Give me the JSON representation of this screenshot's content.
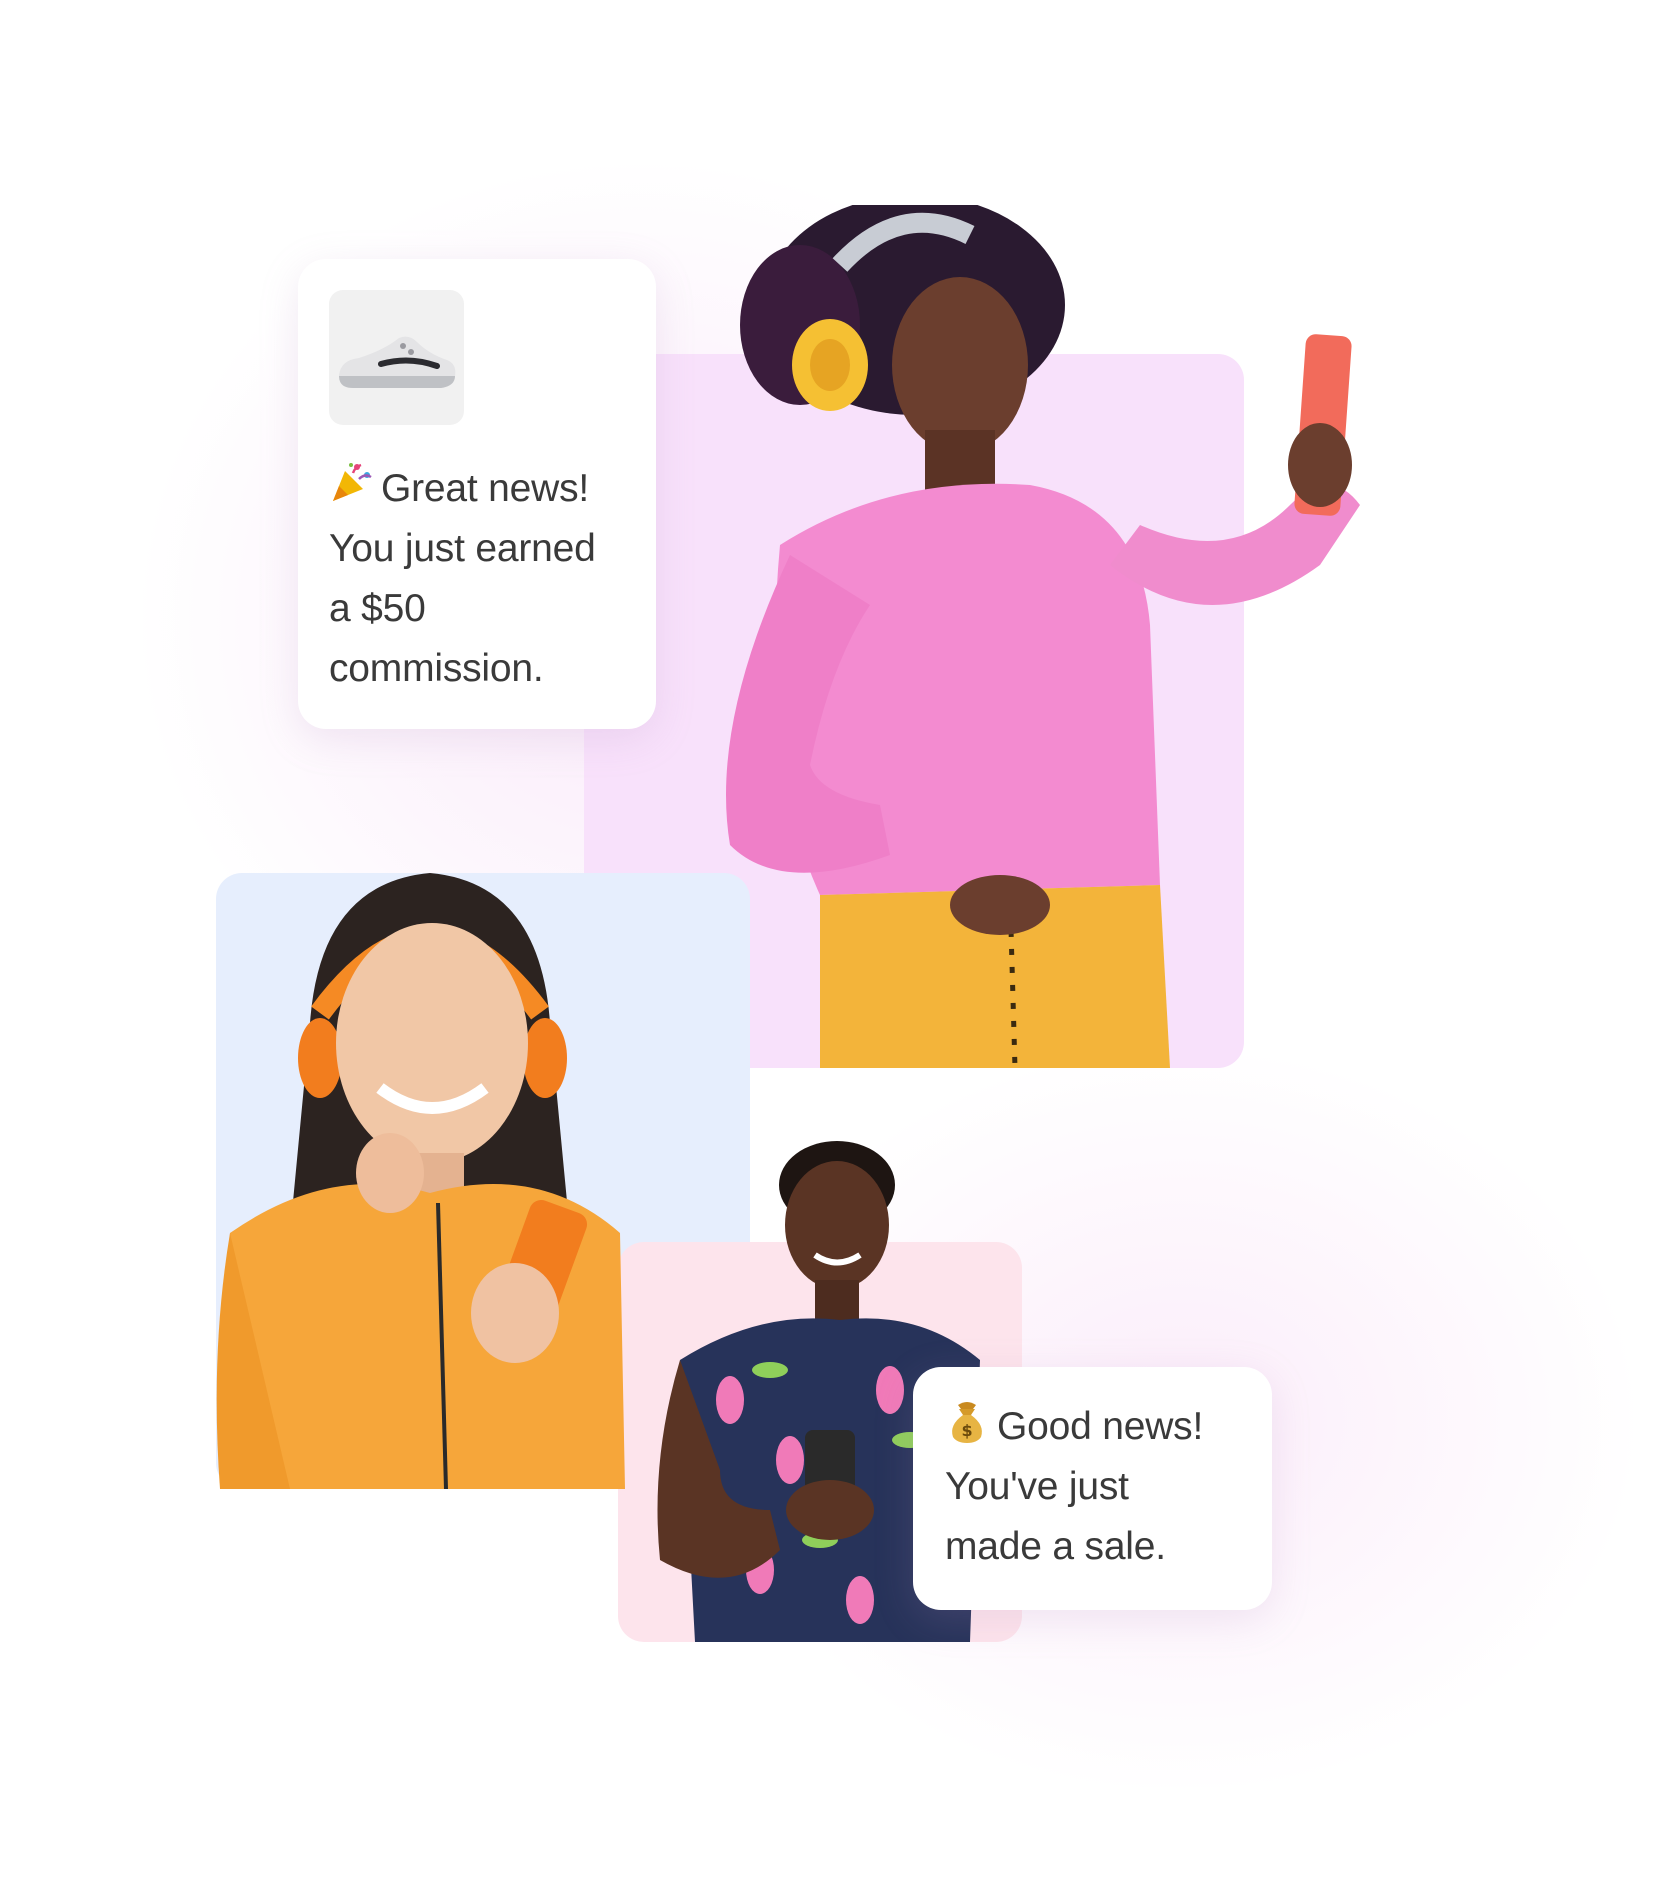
{
  "cards": {
    "commission": {
      "emoji_icon": "party-popper-icon",
      "lines": [
        "Great news!",
        "You just earned",
        "a $50",
        "commission."
      ],
      "thumbnail_icon": "sneaker-icon"
    },
    "sale": {
      "emoji_icon": "money-bag-icon",
      "lines": [
        "Good news!",
        "You've just",
        "made a sale."
      ]
    }
  },
  "colors": {
    "panel_lilac": "#f8e1fb",
    "panel_blue": "#e6eefd",
    "panel_pink": "#fde4ec",
    "sweater_pink": "#f38bd0",
    "jacket_orange": "#f6a63a",
    "text": "#3a3a3a"
  }
}
